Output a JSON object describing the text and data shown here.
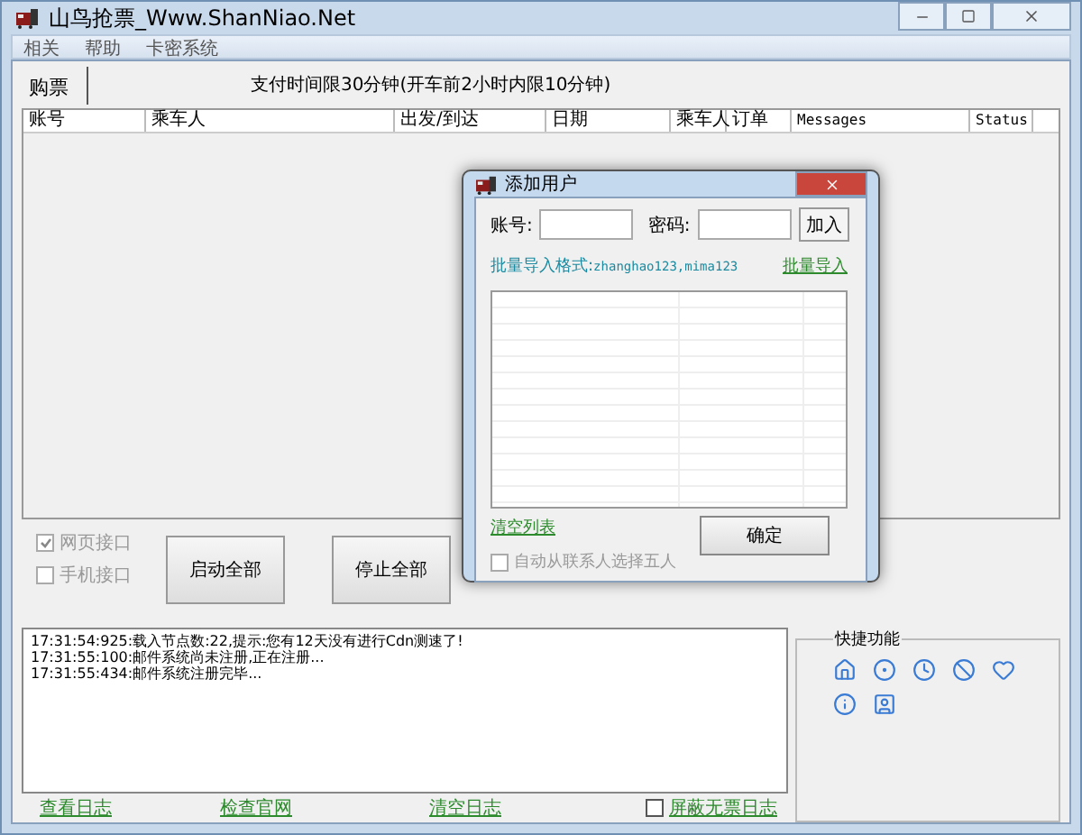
{
  "window": {
    "title": "山鸟抢票_Www.ShanNiao.Net"
  },
  "menu": [
    "相关",
    "帮助",
    "卡密系统"
  ],
  "tabs": [
    {
      "label": "购票",
      "selected": true
    }
  ],
  "notice": "支付时间限30分钟(开车前2小时内限10分钟)",
  "table": {
    "columns": [
      "账号",
      "乘车人",
      "出发/到达",
      "日期",
      "乘车人",
      "订单",
      "Messages",
      "Status"
    ]
  },
  "interfaces": [
    {
      "label": "网页接口",
      "checked": true,
      "disabled": true
    },
    {
      "label": "手机接口",
      "checked": false,
      "disabled": true
    }
  ],
  "buttons": [
    "启动全部",
    "停止全部"
  ],
  "log": [
    "17:31:54:925:载入节点数:22,提示:您有12天没有进行Cdn测速了!",
    "17:31:55:100:邮件系统尚未注册,正在注册...",
    "17:31:55:434:邮件系统注册完毕..."
  ],
  "log_links": [
    "查看日志",
    "检查官网",
    "清空日志"
  ],
  "hide_no_ticket": {
    "label": "屏蔽无票日志",
    "checked": false
  },
  "quick_functions": {
    "title": "快捷功能",
    "icons": [
      {
        "kind": "home"
      },
      {
        "kind": "target"
      },
      {
        "kind": "clock"
      },
      {
        "kind": "ban"
      },
      {
        "kind": "heart"
      },
      {
        "kind": "info"
      },
      {
        "kind": "contact"
      }
    ]
  },
  "dialog": {
    "title": "添加用户",
    "account_label": "账号:",
    "password_label": "密码:",
    "add_button": "加入",
    "format_hint": "批量导入格式:",
    "format_example": "zhanghao123,mima123",
    "bulk_import": "批量导入",
    "clear_list": "清空列表",
    "auto_select": {
      "label": "自动从联系人选择五人",
      "checked": false,
      "disabled": true
    },
    "ok_button": "确定"
  }
}
